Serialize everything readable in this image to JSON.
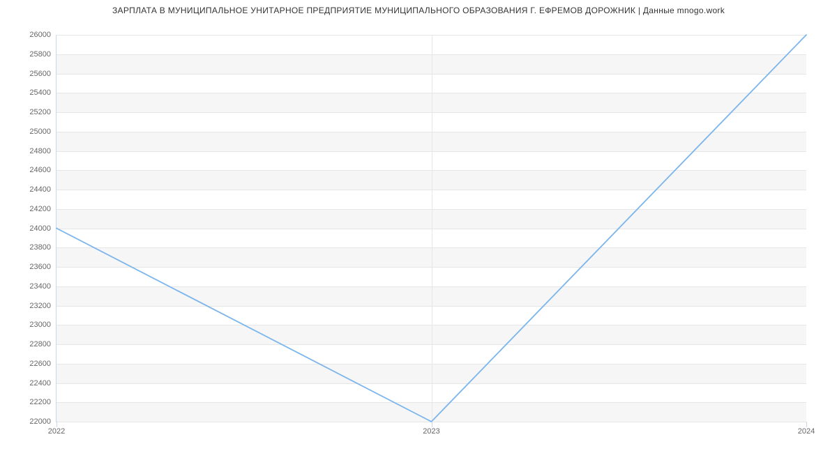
{
  "chart_data": {
    "type": "line",
    "title": "ЗАРПЛАТА В МУНИЦИПАЛЬНОЕ УНИТАРНОЕ ПРЕДПРИЯТИЕ МУНИЦИПАЛЬНОГО ОБРАЗОВАНИЯ Г. ЕФРЕМОВ ДОРОЖНИК | Данные mnogo.work",
    "xlabel": "",
    "ylabel": "",
    "categories": [
      "2022",
      "2023",
      "2024"
    ],
    "values": [
      24000,
      22000,
      26000
    ],
    "ylim": [
      22000,
      26000
    ],
    "y_ticks": [
      22000,
      22200,
      22400,
      22600,
      22800,
      23000,
      23200,
      23400,
      23600,
      23800,
      24000,
      24200,
      24400,
      24600,
      24800,
      25000,
      25200,
      25400,
      25600,
      25800,
      26000
    ],
    "grid": {
      "x": true,
      "y": true,
      "bands": true
    }
  }
}
